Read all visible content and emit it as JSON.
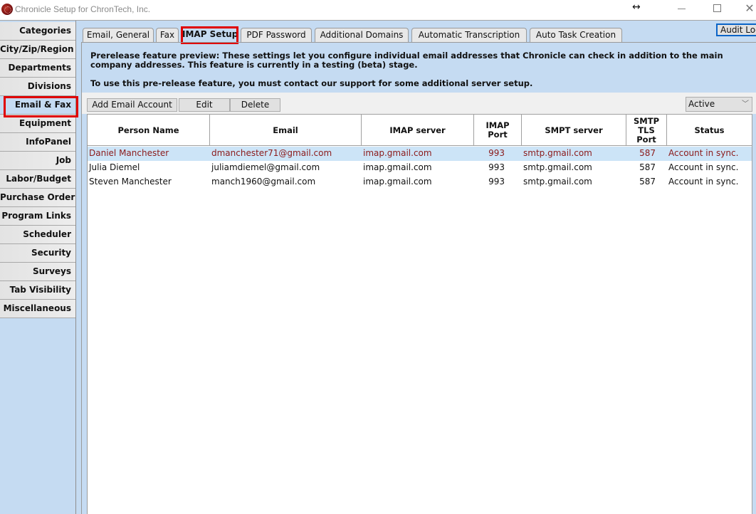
{
  "window": {
    "title": "Chronicle Setup for ChronTech, Inc.",
    "icons": {
      "app": "chronicle-app-icon",
      "resize": "horizontal-resize-icon",
      "minimize": "minimize-icon",
      "maximize": "maximize-icon",
      "close": "close-icon"
    },
    "close_glyph": "✕",
    "resize_glyph": "↔"
  },
  "sidebar": {
    "items": [
      {
        "label": "Categories"
      },
      {
        "label": "City/Zip/Region"
      },
      {
        "label": "Departments"
      },
      {
        "label": "Divisions"
      },
      {
        "label": "Email & Fax",
        "active": true
      },
      {
        "label": "Equipment"
      },
      {
        "label": "InfoPanel"
      },
      {
        "label": "Job"
      },
      {
        "label": "Labor/Budget"
      },
      {
        "label": "Purchase Order"
      },
      {
        "label": "Program Links"
      },
      {
        "label": "Scheduler"
      },
      {
        "label": "Security"
      },
      {
        "label": "Surveys"
      },
      {
        "label": "Tab Visibility"
      },
      {
        "label": "Miscellaneous"
      }
    ]
  },
  "tabs": [
    {
      "label": "Email, General"
    },
    {
      "label": "Fax"
    },
    {
      "label": "IMAP Setup",
      "active": true
    },
    {
      "label": "PDF Password"
    },
    {
      "label": "Additional Domains"
    },
    {
      "label": "Automatic Transcription"
    },
    {
      "label": "Auto Task Creation"
    }
  ],
  "audit_log_label": "Audit Log",
  "notice": {
    "line1": "Prerelease feature preview: These settings let you configure individual email addresses that Chronicle can check in addition to the main company addresses. This feature is currently in a testing (beta) stage.",
    "line2": "To use this pre-release feature, you must contact our support for some additional server setup."
  },
  "toolbar": {
    "add_label": "Add Email Account",
    "edit_label": "Edit",
    "delete_label": "Delete",
    "filter_value": "Active",
    "filter_chevron": "﹀"
  },
  "table": {
    "columns": [
      "Person Name",
      "Email",
      "IMAP server",
      "IMAP Port",
      "SMPT server",
      "SMTP TLS Port",
      "Status"
    ],
    "rows": [
      {
        "name": "Daniel Manchester",
        "email": "dmanchester71@gmail.com",
        "imap_server": "imap.gmail.com",
        "imap_port": "993",
        "smtp_server": "smtp.gmail.com",
        "smtp_port": "587",
        "status": "Account in sync.",
        "selected": true
      },
      {
        "name": "Julia Diemel",
        "email": "juliamdiemel@gmail.com",
        "imap_server": "imap.gmail.com",
        "imap_port": "993",
        "smtp_server": "smtp.gmail.com",
        "smtp_port": "587",
        "status": "Account in sync."
      },
      {
        "name": "Steven Manchester",
        "email": "manch1960@gmail.com",
        "imap_server": "imap.gmail.com",
        "imap_port": "993",
        "smtp_server": "smtp.gmail.com",
        "smtp_port": "587",
        "status": "Account in sync."
      }
    ]
  },
  "colors": {
    "panel_bg": "#c5dbf2",
    "highlight_red": "#e00000",
    "selected_row_bg": "#cce4f7",
    "selected_row_text": "#8b1a1a"
  }
}
